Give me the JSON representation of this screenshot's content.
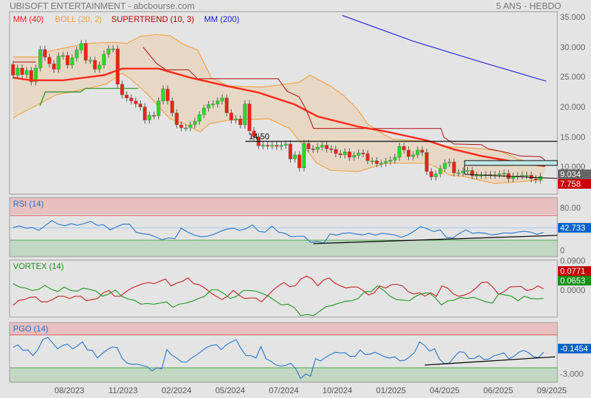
{
  "header": {
    "title": "UBISOFT ENTERTAINMENT - abcbourse.com",
    "period": "5 ANS - HEBDO"
  },
  "legend": {
    "mm40": "MM (40)",
    "boll": "BOLL (20, 2)",
    "supertrend": "SUPERTREND (10, 3)",
    "mm200": "MM (200)"
  },
  "colors": {
    "up": "#22dd22",
    "down": "#ee2211",
    "mm40": "#ff2a1a",
    "boll": "#f4a040",
    "bollfill": "#e8d6bf",
    "supertrend": "#aa0000",
    "mm200": "#2222dd",
    "rsi": "#2a7ad0",
    "vortex_plus": "#229922",
    "vortex_minus": "#cc2222"
  },
  "price_axis": [
    "35.000",
    "30.000",
    "25.000",
    "20.000",
    "15.000",
    "10.000"
  ],
  "price_badges": {
    "last": "9.034",
    "low": "7.758"
  },
  "annotation": {
    "level": "14.50"
  },
  "x_axis": [
    "08/2023",
    "11/2023",
    "02/2024",
    "05/2024",
    "07/2024",
    "10/2024",
    "01/2025",
    "04/2025",
    "06/2025",
    "09/2025"
  ],
  "rsi": {
    "title": "RSI (14)",
    "axis_top": "80.00",
    "axis_bottom": "0",
    "value": "42.733"
  },
  "vortex": {
    "title": "VORTEX (14)",
    "axis_top": "0.0900",
    "axis_bottom": "0.0000",
    "minus_value": "0.0771",
    "plus_value": "0.0653"
  },
  "pgo": {
    "title": "PGO (14)",
    "axis_bottom": "-3.000",
    "value": "-0.1454"
  },
  "chart_data": {
    "type": "candlestick",
    "title": "UBISOFT ENTERTAINMENT",
    "ylim": [
      7,
      35
    ],
    "closes": [
      25.3,
      26.5,
      25.4,
      26.1,
      24.2,
      26.5,
      29.6,
      28.3,
      27.2,
      26.3,
      28.5,
      28.6,
      27.0,
      28.2,
      29.5,
      30.6,
      27.8,
      27.8,
      26.3,
      27.0,
      28.8,
      29.7,
      29.7,
      23.8,
      22.0,
      21.5,
      21.0,
      20.5,
      20.0,
      17.8,
      18.6,
      18.5,
      21.0,
      23.0,
      21.0,
      19.0,
      17.0,
      16.5,
      16.5,
      17.0,
      17.6,
      18.7,
      19.8,
      20.4,
      20.5,
      21.0,
      21.5,
      19.0,
      17.8,
      18.0,
      17.0,
      20.5,
      16.0,
      15.0,
      13.5,
      13.6,
      13.5,
      13.6,
      13.4,
      13.6,
      13.8,
      11.3,
      12.0,
      9.8,
      13.9,
      13.0,
      12.9,
      13.3,
      13.6,
      13.0,
      12.9,
      12.2,
      12.0,
      12.5,
      11.6,
      11.9,
      12.3,
      12.2,
      11.0,
      11.0,
      10.5,
      10.6,
      10.9,
      11.1,
      11.6,
      13.4,
      12.8,
      11.7,
      12.0,
      12.8,
      12.4,
      9.2,
      8.3,
      8.8,
      9.7,
      10.6,
      10.8,
      9.0,
      9.0,
      9.3,
      9.4,
      8.5,
      8.6,
      8.6,
      8.7,
      8.6,
      8.7,
      8.8,
      8.9,
      8.0,
      8.4,
      8.5,
      8.6,
      8.6,
      8.0,
      7.8,
      8.4
    ],
    "first_open": 27.1,
    "mm40": [
      [
        0,
        24.9
      ],
      [
        4,
        24.45
      ],
      [
        11,
        24.45
      ],
      [
        20,
        25.3
      ],
      [
        24,
        26.4
      ],
      [
        32,
        26.4
      ],
      [
        39,
        24.9
      ],
      [
        47,
        23.5
      ],
      [
        54,
        22.4
      ],
      [
        62,
        20.4
      ],
      [
        67,
        18.4
      ],
      [
        76,
        16.7
      ],
      [
        82,
        15.9
      ],
      [
        91,
        14.4
      ],
      [
        97,
        12.9
      ],
      [
        103,
        11.8
      ],
      [
        112,
        10.6
      ],
      [
        117,
        10.1
      ]
    ],
    "boll_upper": [
      [
        0,
        28.35
      ],
      [
        5.8,
        28.35
      ],
      [
        7.9,
        29.3
      ],
      [
        14.8,
        30.4
      ],
      [
        15.9,
        30.6
      ],
      [
        22.4,
        30.8
      ],
      [
        25,
        30.6
      ],
      [
        28,
        31.8
      ],
      [
        31.5,
        32.1
      ],
      [
        34.5,
        31.9
      ],
      [
        37.6,
        30.4
      ],
      [
        40.6,
        29.5
      ],
      [
        43.6,
        24.9
      ],
      [
        47.3,
        23.5
      ],
      [
        54.8,
        23.3
      ],
      [
        59.8,
        23.8
      ],
      [
        62.9,
        24.1
      ],
      [
        65.3,
        25.3
      ],
      [
        69.8,
        23.5
      ],
      [
        72.9,
        21.8
      ],
      [
        75.9,
        19.5
      ],
      [
        77.9,
        17.2
      ],
      [
        80.9,
        15.7
      ],
      [
        83.5,
        14.6
      ],
      [
        88,
        14.4
      ],
      [
        92.1,
        14.1
      ],
      [
        95.2,
        13.4
      ],
      [
        99.1,
        13.2
      ],
      [
        103.2,
        13.0
      ],
      [
        107.3,
        12.6
      ],
      [
        111.2,
        11.2
      ],
      [
        117.3,
        10.3
      ]
    ],
    "boll_lower": [
      [
        0,
        18.1
      ],
      [
        1.2,
        18.7
      ],
      [
        5.3,
        20.3
      ],
      [
        9.4,
        22.0
      ],
      [
        15.9,
        23.0
      ],
      [
        20.5,
        23.8
      ],
      [
        23.9,
        25.6
      ],
      [
        25.5,
        24.9
      ],
      [
        29.5,
        22.2
      ],
      [
        34.5,
        18.0
      ],
      [
        37.6,
        17.2
      ],
      [
        41.2,
        15.8
      ],
      [
        43.2,
        17.2
      ],
      [
        47.3,
        17.8
      ],
      [
        56.4,
        18.0
      ],
      [
        59.4,
        16.9
      ],
      [
        60.8,
        16.4
      ],
      [
        63.8,
        13.6
      ],
      [
        66.8,
        10.6
      ],
      [
        69.8,
        9.4
      ],
      [
        75.9,
        9.2
      ],
      [
        82,
        10.6
      ],
      [
        91,
        10.6
      ],
      [
        93,
        10.0
      ],
      [
        96,
        8.6
      ],
      [
        99,
        8.4
      ],
      [
        106,
        7.2
      ],
      [
        116.4,
        7.8
      ]
    ],
    "supertrend_upper": [
      [
        28.6,
        30.0
      ],
      [
        31.5,
        27.3
      ],
      [
        33.6,
        26.2
      ],
      [
        38.6,
        26.2
      ],
      [
        40.6,
        24.7
      ],
      [
        58.3,
        24.7
      ],
      [
        60.3,
        22.6
      ],
      [
        62.9,
        21.7
      ],
      [
        64.5,
        19.5
      ],
      [
        66.1,
        16.4
      ],
      [
        94.1,
        16.4
      ],
      [
        94.8,
        14.9
      ],
      [
        97,
        13.8
      ],
      [
        103,
        13.7
      ],
      [
        104.5,
        13.0
      ],
      [
        108.5,
        12.4
      ],
      [
        111.5,
        11.8
      ],
      [
        116,
        11.7
      ],
      [
        117,
        11.1
      ]
    ],
    "supertrend_upper_early": [
      [
        0,
        27.5
      ],
      [
        5,
        27.5
      ]
    ],
    "supertrend_lower": [
      [
        5.9,
        20.2
      ],
      [
        7.1,
        22.5
      ],
      [
        14.8,
        22.5
      ],
      [
        15.9,
        23.1
      ],
      [
        27.5,
        23.1
      ]
    ],
    "mm200": [
      [
        72.4,
        35.3
      ],
      [
        88,
        31.0
      ],
      [
        103,
        27.5
      ],
      [
        117.3,
        24.3
      ]
    ],
    "rsi": [
      50.4,
      53.0,
      49.6,
      50.4,
      45.9,
      54.1,
      61.5,
      56.0,
      53.3,
      56.7,
      54.1,
      57.0,
      60.4,
      54.1,
      54.8,
      46.7,
      51.5,
      56.0,
      56.0,
      43.0,
      40.4,
      39.3,
      35.6,
      30.7,
      33.7,
      32.6,
      49.3,
      43.0,
      38.5,
      35.6,
      36.3,
      39.3,
      44.1,
      47.8,
      49.3,
      45.9,
      48.5,
      54.8,
      44.1,
      43.0,
      53.0,
      43.0,
      41.1,
      35.6,
      36.3,
      36.3,
      26.3,
      28.1,
      25.2,
      40.0,
      38.1,
      41.1,
      41.9,
      40.0,
      38.5,
      41.1,
      38.1,
      41.1,
      40.0,
      38.5,
      34.8,
      38.5,
      44.8,
      52.2,
      48.5,
      44.1,
      46.7,
      34.4,
      33.7,
      41.1,
      46.7,
      41.1,
      42.2,
      41.1,
      38.5,
      40.0,
      41.9,
      41.1,
      43.0,
      44.4,
      43.0,
      39.3,
      42.7
    ],
    "vortex_minus": [
      0.875,
      0.93,
      0.938,
      0.963,
      0.968,
      0.913,
      0.913,
      0.938,
      0.975,
      0.975,
      0.95,
      0.975,
      0.975,
      0.925,
      0.938,
      0.95,
      1.013,
      1.038,
      0.975,
      0.975,
      1.025,
      1.063,
      1.088,
      1.113,
      1.125,
      1.113,
      1.138,
      1.163,
      1.088,
      1.118,
      1.138,
      1.175,
      1.113,
      1.1,
      1.063,
      1.013,
      0.975,
      0.938,
      0.975,
      1.038,
      0.988,
      0.95,
      0.955,
      0.955,
      0.913,
      0.975,
      1.038,
      1.088,
      1.125,
      1.08,
      1.088,
      1.163,
      1.195,
      1.163,
      1.088,
      1.15,
      1.175,
      1.118,
      1.088,
      1.065,
      1.075,
      1.075,
      1.038,
      0.988,
      1.013,
      1.088,
      1.063,
      1.1,
      1.105,
      1.088,
      1.025,
      1.0,
      1.013,
      0.975,
      1.013,
      0.975,
      1.088,
      1.063,
      1.0,
      0.975,
      0.988,
      1.013,
      1.063,
      1.125,
      1.13,
      1.075,
      0.995,
      1.025,
      1.075,
      1.08,
      1.083,
      1.038,
      1.05,
      1.088,
      1.055
    ],
    "vortex_plus": [
      1.113,
      1.075,
      1.063,
      1.038,
      1.05,
      1.093,
      1.05,
      1.025,
      1.075,
      1.038,
      1.03,
      1.063,
      1.05,
      1.03,
      0.975,
      1.0,
      1.043,
      0.975,
      0.945,
      0.93,
      0.888,
      0.895,
      0.888,
      0.9,
      0.913,
      0.855,
      0.888,
      0.9,
      0.92,
      0.95,
      0.975,
      1.045,
      1.045,
      1.005,
      0.95,
      0.975,
      1.038,
      1.038,
      1.03,
      1.005,
      0.975,
      0.925,
      0.88,
      0.888,
      0.85,
      0.763,
      0.775,
      0.763,
      0.813,
      0.863,
      0.875,
      0.9,
      0.92,
      0.925,
      0.95,
      1.025,
      1.025,
      1.088,
      1.038,
      0.975,
      0.938,
      0.933,
      0.925,
      0.975,
      1.005,
      1.013,
      0.963,
      0.88,
      0.925,
      0.933,
      0.963,
      0.95,
      0.963,
      0.938,
      0.913,
      0.9,
      1.0,
      0.988,
      0.975,
      0.925,
      0.975,
      0.95,
      0.945,
      0.95
    ],
    "pgo": [
      0.75,
      1.17,
      0.17,
      0.25,
      -0.79,
      0.33,
      2.13,
      2.54,
      1.5,
      0.46,
      1.08,
      1.29,
      0.46,
      1.0,
      1.71,
      0.25,
      0.17,
      -1.21,
      -0.38,
      0.33,
      0.79,
      0.67,
      -1.29,
      -2.13,
      -2.38,
      -2.33,
      -2.58,
      -2.75,
      -3.58,
      -3.0,
      -3.17,
      0.33,
      -0.67,
      -1.21,
      -1.92,
      -1.96,
      -1.21,
      -0.67,
      0.04,
      0.67,
      1.08,
      1.21,
      0.33,
      1.17,
      1.71,
      2.13,
      0.46,
      -0.79,
      -0.79,
      -1.21,
      0.88,
      -1.33,
      -1.83,
      -2.46,
      -2.67,
      -2.58,
      -2.17,
      -3.17,
      -4.96,
      -4.13,
      -4.54,
      -1.33,
      -1.75,
      -1.13,
      -0.58,
      -0.17,
      -0.29,
      -0.25,
      -0.92,
      -0.92,
      0.25,
      -0.58,
      -0.5,
      -0.17,
      -0.58,
      -1.0,
      -1.21,
      -1.0,
      -1.71,
      -1.63,
      -1.0,
      -0.17,
      1.71,
      1.08,
      0.04,
      0.46,
      -1.42,
      -2.25,
      -2.13,
      -1.0,
      -0.08,
      -0.17,
      -1.33,
      -1.29,
      -0.79,
      -1.5,
      -1.42,
      -0.79,
      -0.58,
      -0.29,
      -1.33,
      -0.92,
      -0.17,
      0.17,
      -0.25,
      -1.0,
      -1.13,
      -0.15
    ]
  }
}
